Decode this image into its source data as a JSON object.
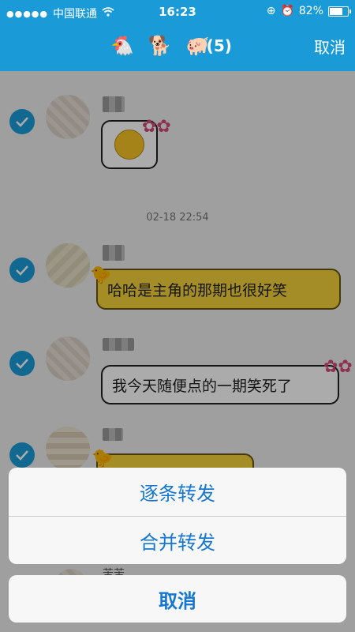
{
  "status_bar": {
    "carrier": "中国联通",
    "time": "16:23",
    "battery": "82%"
  },
  "nav": {
    "icons": [
      "🐔",
      "🐕",
      "🐖"
    ],
    "count": "(5)",
    "cancel_label": "取消"
  },
  "messages": [
    {
      "name": "张张",
      "type": "sticker"
    },
    {
      "timestamp": "02-18 22:54"
    },
    {
      "name": "小男",
      "text": "哈哈是主角的那期也很好笑",
      "style": "yellow"
    },
    {
      "name": "■■■",
      "text": "我今天随便点的一期笑死了",
      "style": "white"
    },
    {
      "name": "■■",
      "type": "partial"
    },
    {
      "name": "苦苦",
      "type": "partial"
    }
  ],
  "action_sheet": {
    "options": [
      "逐条转发",
      "合并转发"
    ],
    "cancel_label": "取消"
  },
  "colors": {
    "accent": "#1a9bd7",
    "action_text": "#1677d2"
  }
}
